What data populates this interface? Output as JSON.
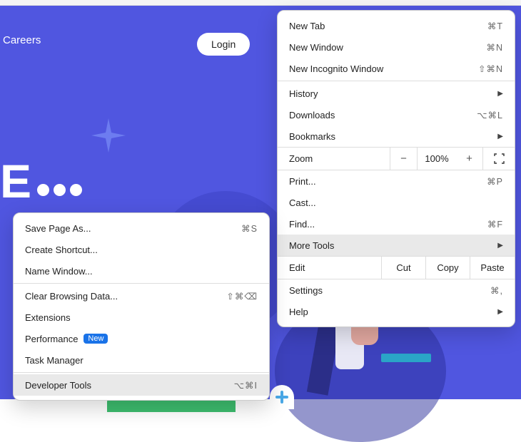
{
  "nav": {
    "careers": "Careers",
    "login": "Login"
  },
  "hero": {
    "letter": "E"
  },
  "main_menu": {
    "new_tab": {
      "label": "New Tab",
      "shortcut": "⌘T"
    },
    "new_window": {
      "label": "New Window",
      "shortcut": "⌘N"
    },
    "new_incognito": {
      "label": "New Incognito Window",
      "shortcut": "⇧⌘N"
    },
    "history": {
      "label": "History"
    },
    "downloads": {
      "label": "Downloads",
      "shortcut": "⌥⌘L"
    },
    "bookmarks": {
      "label": "Bookmarks"
    },
    "zoom": {
      "label": "Zoom",
      "value": "100%"
    },
    "print": {
      "label": "Print...",
      "shortcut": "⌘P"
    },
    "cast": {
      "label": "Cast..."
    },
    "find": {
      "label": "Find...",
      "shortcut": "⌘F"
    },
    "more_tools": {
      "label": "More Tools"
    },
    "edit": {
      "label": "Edit",
      "cut": "Cut",
      "copy": "Copy",
      "paste": "Paste"
    },
    "settings": {
      "label": "Settings",
      "shortcut": "⌘,"
    },
    "help": {
      "label": "Help"
    }
  },
  "sub_menu": {
    "save_page": {
      "label": "Save Page As...",
      "shortcut": "⌘S"
    },
    "create_shortcut": {
      "label": "Create Shortcut..."
    },
    "name_window": {
      "label": "Name Window..."
    },
    "clear_browsing": {
      "label": "Clear Browsing Data...",
      "shortcut": "⇧⌘⌫"
    },
    "extensions": {
      "label": "Extensions"
    },
    "performance": {
      "label": "Performance",
      "badge": "New"
    },
    "task_manager": {
      "label": "Task Manager"
    },
    "dev_tools": {
      "label": "Developer Tools",
      "shortcut": "⌥⌘I"
    }
  }
}
